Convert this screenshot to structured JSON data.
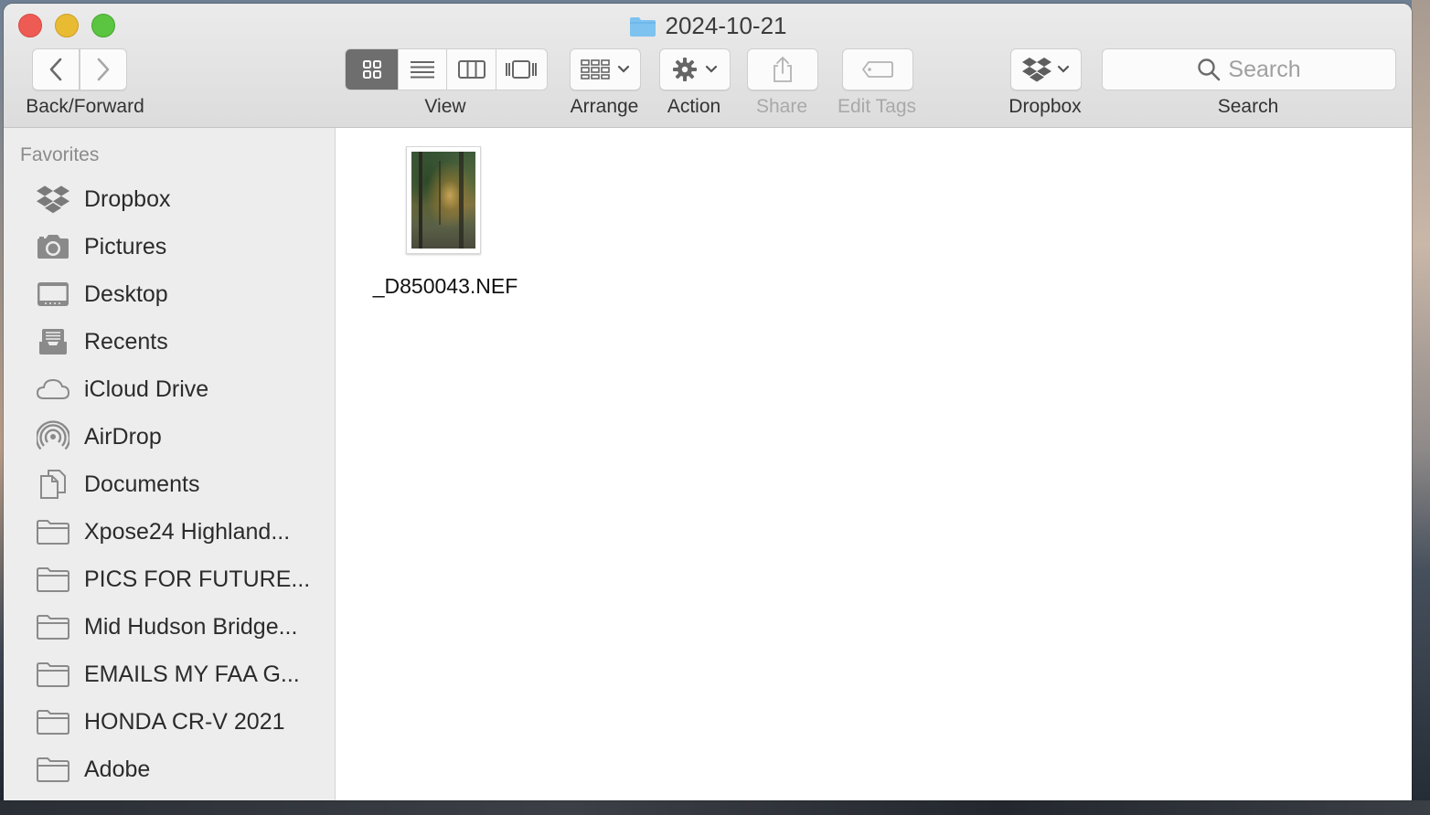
{
  "window": {
    "title": "2024-10-21",
    "controls": [
      "close",
      "minimize",
      "zoom"
    ]
  },
  "toolbar": {
    "back_forward_label": "Back/Forward",
    "view_label": "View",
    "view_modes": [
      "icon-view",
      "list-view",
      "column-view",
      "gallery-view"
    ],
    "active_view": "icon-view",
    "arrange_label": "Arrange",
    "action_label": "Action",
    "share_label": "Share",
    "edit_tags_label": "Edit Tags",
    "dropbox_label": "Dropbox",
    "search_label": "Search",
    "search_placeholder": "Search"
  },
  "sidebar": {
    "heading": "Favorites",
    "items": [
      {
        "label": "Dropbox",
        "icon": "dropbox-icon"
      },
      {
        "label": "Pictures",
        "icon": "camera-icon"
      },
      {
        "label": "Desktop",
        "icon": "desktop-icon"
      },
      {
        "label": "Recents",
        "icon": "recents-icon"
      },
      {
        "label": "iCloud Drive",
        "icon": "cloud-icon"
      },
      {
        "label": "AirDrop",
        "icon": "airdrop-icon"
      },
      {
        "label": "Documents",
        "icon": "documents-icon"
      },
      {
        "label": "Xpose24 Highland...",
        "icon": "folder-icon"
      },
      {
        "label": "PICS FOR FUTURE...",
        "icon": "folder-icon"
      },
      {
        "label": "Mid Hudson Bridge...",
        "icon": "folder-icon"
      },
      {
        "label": "EMAILS MY FAA G...",
        "icon": "folder-icon"
      },
      {
        "label": "HONDA CR-V 2021",
        "icon": "folder-icon"
      },
      {
        "label": "Adobe",
        "icon": "folder-icon"
      }
    ]
  },
  "files": [
    {
      "name": "_D850043.NEF",
      "type": "photo-thumbnail"
    }
  ],
  "colors": {
    "close": "#ee5b55",
    "minimize": "#e8bb33",
    "zoom": "#5bc440",
    "folder": "#7ec2f0",
    "active_segment": "#6e6e6e"
  }
}
